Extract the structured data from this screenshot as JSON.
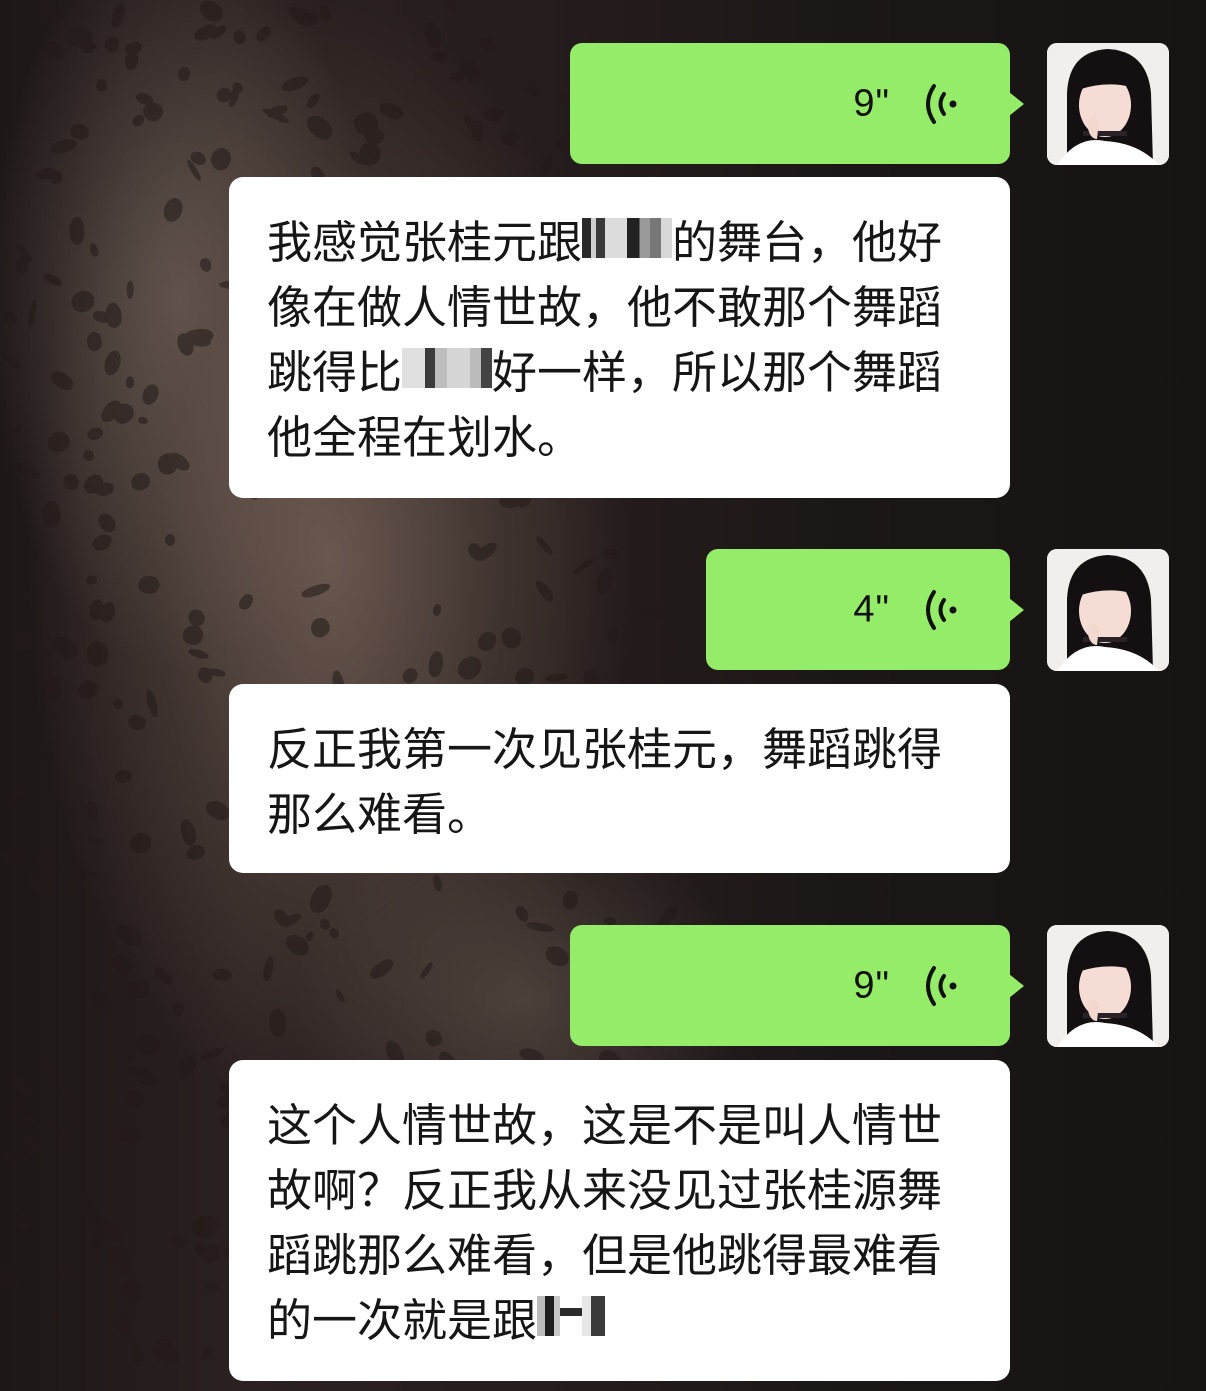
{
  "messages": [
    {
      "type": "voice",
      "duration": "9\""
    },
    {
      "type": "transcript",
      "text": "我感觉张桂元跟"
    },
    {
      "type": "voice",
      "duration": "4\""
    },
    {
      "type": "transcript",
      "text": "反正我第一次见张桂元，舞蹈跳得那么难看。"
    },
    {
      "type": "voice",
      "duration": "9\""
    },
    {
      "type": "transcript",
      "text": "这个人情世故，这是不是叫人情世故啊？反正我从来没见过张桂源舞蹈跳那么难看，但是他跳得最难看的一次就是跟"
    }
  ],
  "transcript1": {
    "part_a": "我感觉张桂元跟",
    "part_b": "的舞台，他好像在做人情世故，他不敢那个舞蹈跳得比",
    "part_c": "好一样，所以那个舞蹈他全程在划水。"
  },
  "colors": {
    "voice_bubble": "#95ec69",
    "text_bubble": "#ffffff",
    "text": "#161616"
  },
  "icons": {
    "voice": "voice-wave-icon",
    "avatar": "avatar"
  }
}
